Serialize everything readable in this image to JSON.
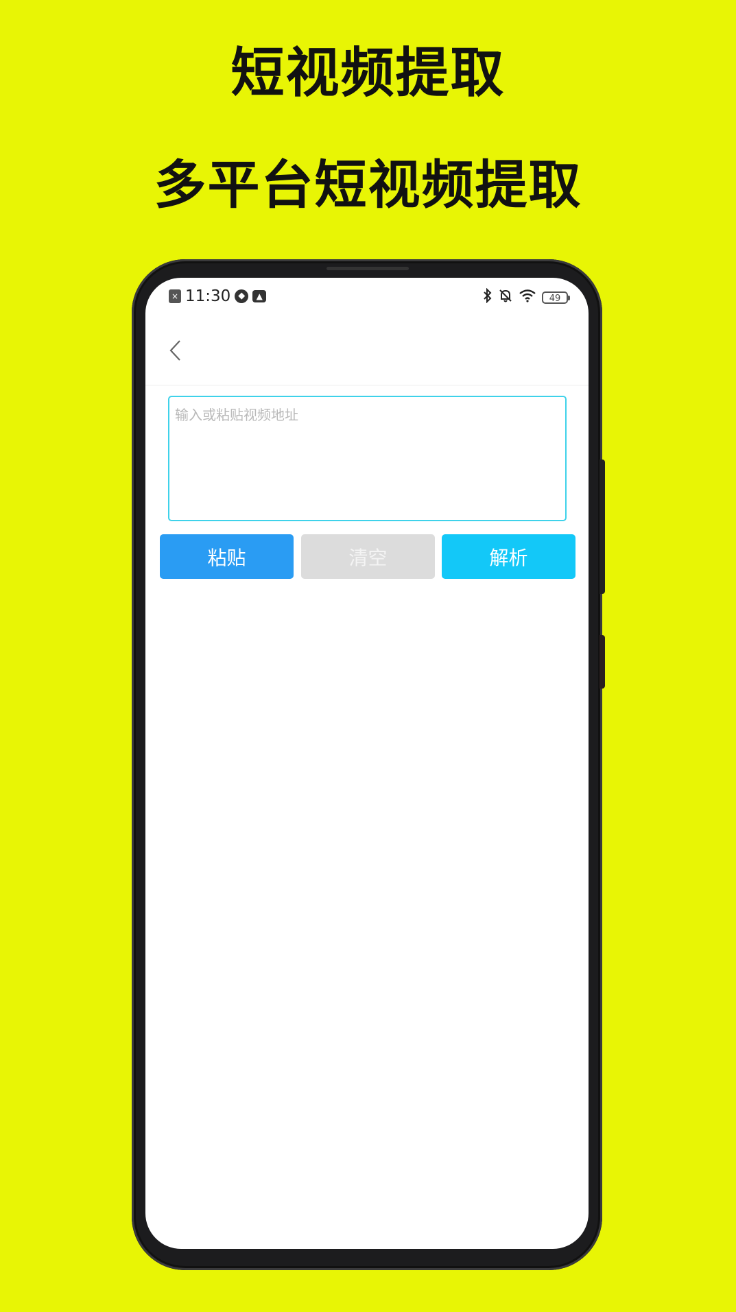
{
  "promo": {
    "title": "短视频提取",
    "subtitle": "多平台短视频提取"
  },
  "status_bar": {
    "time": "11:30",
    "battery": "49",
    "left_icons": [
      "sim-off-icon",
      "compass-icon",
      "gallery-icon"
    ],
    "right_icons": [
      "bluetooth-icon",
      "mute-bell-icon",
      "wifi-icon",
      "battery-icon"
    ]
  },
  "nav": {
    "back_icon": "chevron-left-icon"
  },
  "input": {
    "placeholder": "输入或粘贴视频地址",
    "value": ""
  },
  "buttons": {
    "paste": "粘贴",
    "clear": "清空",
    "parse": "解析"
  },
  "colors": {
    "background": "#e8f505",
    "paste_button": "#2a9cf3",
    "clear_button": "#dcdcdc",
    "parse_button": "#13c8f8",
    "input_border": "#3fd2ea"
  }
}
